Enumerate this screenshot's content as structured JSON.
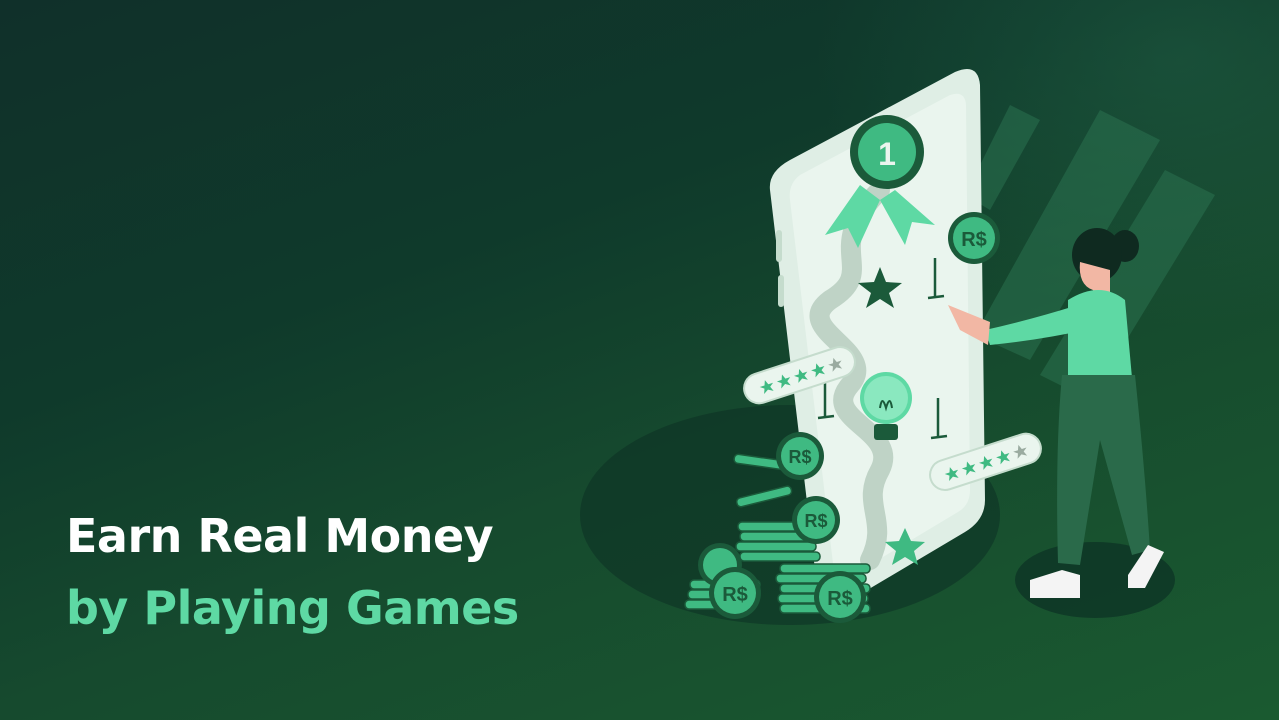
{
  "headline": {
    "line1": "Earn Real Money",
    "line2": "by Playing Games"
  },
  "illustration": {
    "rank_badge": "1",
    "coin_symbol": "R$",
    "rating_bar_top_filled": 4,
    "rating_bar_bottom_filled": 4,
    "rating_max": 5
  },
  "colors": {
    "accent": "#5ed9a4",
    "headline_white": "#ffffff",
    "coin_green": "#3fba82",
    "dark_green": "#1b5a3a",
    "phone_screen": "#e6f2ea"
  }
}
